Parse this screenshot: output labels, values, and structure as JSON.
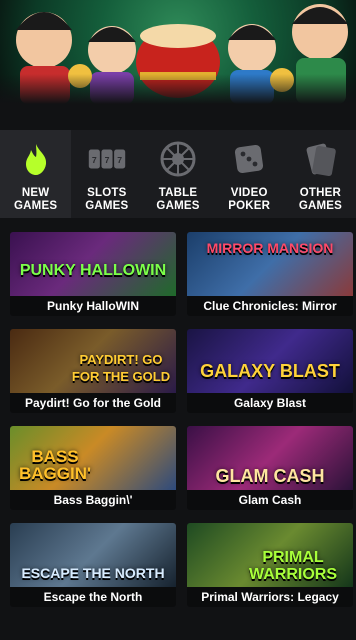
{
  "categories": [
    {
      "label": "NEW\nGAMES",
      "icon": "flame-icon",
      "active": true
    },
    {
      "label": "SLOTS\nGAMES",
      "icon": "slot-reels-icon",
      "active": false
    },
    {
      "label": "TABLE\nGAMES",
      "icon": "roulette-wheel-icon",
      "active": false
    },
    {
      "label": "VIDEO\nPOKER",
      "icon": "dice-icon",
      "active": false
    },
    {
      "label": "OTHER\nGAMES",
      "icon": "cards-icon",
      "active": false
    }
  ],
  "games": [
    {
      "name": "Punky HalloWIN",
      "logo": "PUNKY HALLOWIN",
      "logo_color": "#7cff4a"
    },
    {
      "name": "Clue Chronicles: Mirror",
      "logo": "MIRROR MANSION",
      "logo_color": "#ff4a6a"
    },
    {
      "name": "Paydirt! Go for the Gold",
      "logo": "PAYDIRT! GO FOR THE GOLD",
      "logo_color": "#ffcc33"
    },
    {
      "name": "Galaxy Blast",
      "logo": "GALAXY BLAST",
      "logo_color": "#ffd23a"
    },
    {
      "name": "Bass Baggin\\'",
      "logo": "BASS BAGGIN'",
      "logo_color": "#ffc02a"
    },
    {
      "name": "Glam Cash",
      "logo": "GLAM CASH",
      "logo_color": "#ffe6a0"
    },
    {
      "name": "Escape the North",
      "logo": "ESCAPE THE NORTH",
      "logo_color": "#d8ecff"
    },
    {
      "name": "Primal Warriors: Legacy",
      "logo": "PRIMAL WARRIORS",
      "logo_color": "#a8ff3a"
    }
  ],
  "colors": {
    "background": "#111214",
    "category_bar": "#1b1c1f",
    "category_active": "#26272b",
    "flame": "#b6ff2a",
    "icon_gray": "#6a6b70"
  }
}
